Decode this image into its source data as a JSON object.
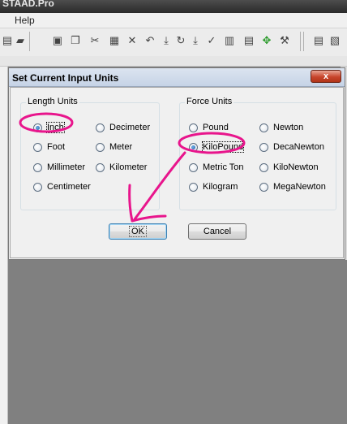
{
  "app": {
    "title": "STAAD.Pro",
    "menu": [
      "Help"
    ]
  },
  "toolbar_icons": [
    "print-icon",
    "open-icon",
    "save-icon",
    "copy-icon",
    "cut-icon",
    "paste-icon",
    "delete-icon",
    "undo-icon",
    "redo-icon",
    "check-icon",
    "calculator-icon",
    "tools-icon",
    "move-icon",
    "hammer-icon"
  ],
  "dialog": {
    "title": "Set Current Input Units",
    "close_label": "x",
    "length_units": {
      "label": "Length Units",
      "options": [
        "Inch",
        "Foot",
        "Millimeter",
        "Centimeter",
        "Decimeter",
        "Meter",
        "Kilometer"
      ],
      "selected": "Inch"
    },
    "force_units": {
      "label": "Force Units",
      "options": [
        "Pound",
        "KiloPound",
        "Metric Ton",
        "Kilogram",
        "Newton",
        "DecaNewton",
        "KiloNewton",
        "MegaNewton"
      ],
      "selected": "KiloPound"
    },
    "ok_label": "OK",
    "cancel_label": "Cancel"
  },
  "colors": {
    "annotation": "#e8158c",
    "workspace": "#808080",
    "radio_dot": "#1c5aa8"
  }
}
